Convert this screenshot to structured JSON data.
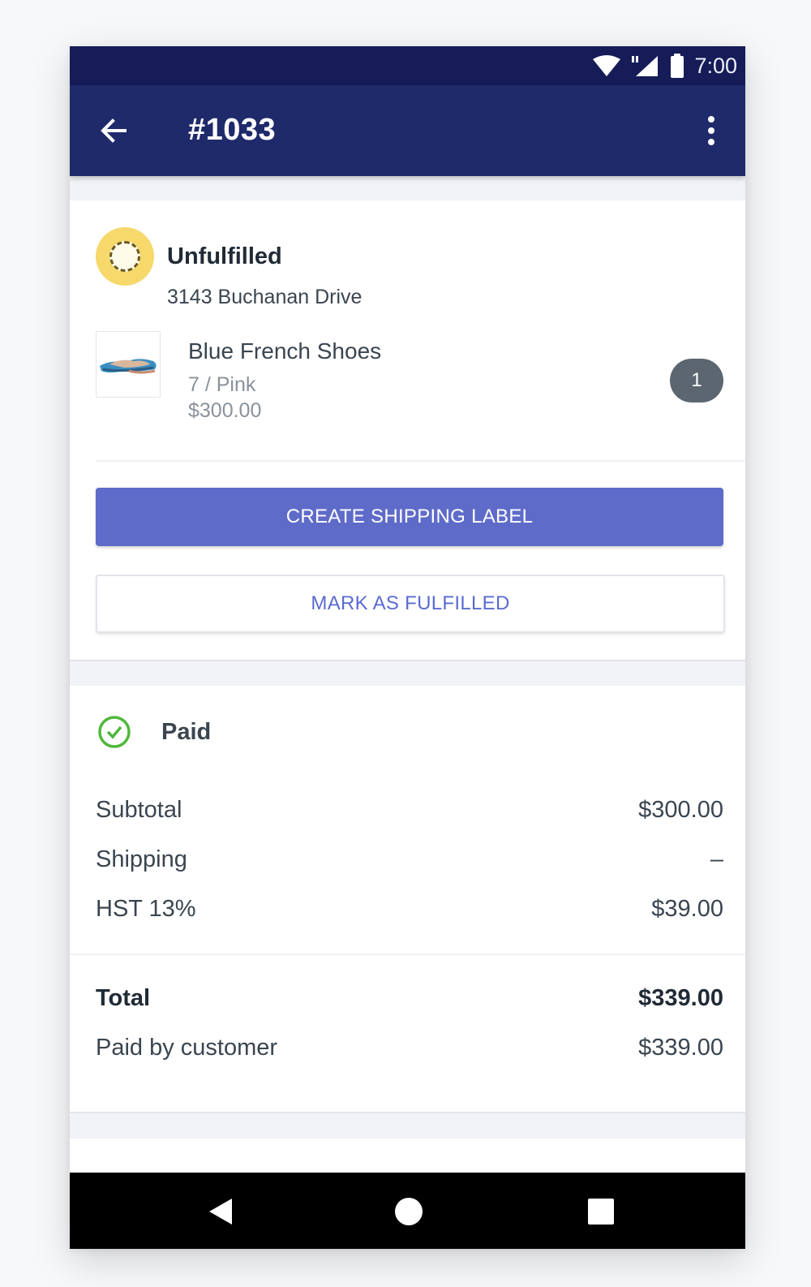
{
  "status_bar": {
    "time": "7:00",
    "icons": [
      "wifi-icon",
      "signal-icon",
      "battery-icon"
    ]
  },
  "app_bar": {
    "title": "#1033",
    "back_icon": "arrow-left-icon",
    "menu_icon": "more-vertical-icon"
  },
  "fulfillment": {
    "status": "Unfulfilled",
    "address": "3143 Buchanan Drive",
    "item": {
      "name": "Blue French Shoes",
      "variant": "7 / Pink",
      "price": "$300.00",
      "quantity": "1"
    },
    "create_label_button": "CREATE SHIPPING LABEL",
    "mark_fulfilled_button": "MARK AS FULFILLED"
  },
  "payment": {
    "status": "Paid",
    "rows": [
      {
        "label": "Subtotal",
        "value": "$300.00"
      },
      {
        "label": "Shipping",
        "value": "–"
      },
      {
        "label": "HST 13%",
        "value": "$39.00"
      }
    ],
    "total": {
      "label": "Total",
      "value": "$339.00"
    },
    "paid_by": {
      "label": "Paid by customer",
      "value": "$339.00"
    }
  },
  "nav_bar": {
    "icons": [
      "nav-back-icon",
      "nav-home-icon",
      "nav-recents-icon"
    ]
  },
  "colors": {
    "app_bar": "#1f2a6b",
    "status_bar": "#151c57",
    "primary_button": "#5f6bc9",
    "unfulfilled_badge": "#f6d86b",
    "paid_check": "#50b83c"
  }
}
